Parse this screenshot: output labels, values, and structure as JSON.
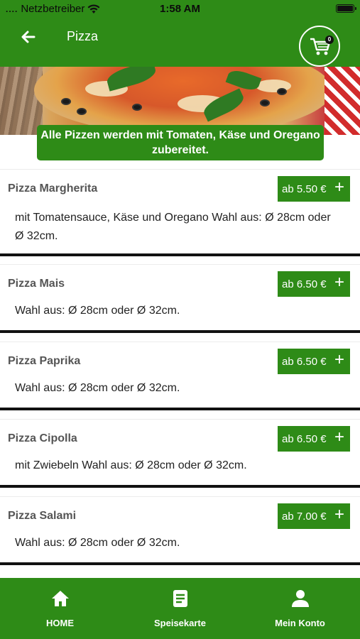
{
  "status_bar": {
    "carrier": "Netzbetreiber",
    "time": "1:58 AM"
  },
  "app_bar": {
    "title": "Pizza",
    "cart_count": "0"
  },
  "banner": {
    "text_line1": "Alle Pizzen werden mit Tomaten, Käse und Oregano",
    "text_line2": "zubereitet."
  },
  "items": [
    {
      "name": "Pizza Margherita",
      "price": "ab 5.50 €",
      "desc_line1": "mit Tomatensauce, Käse und Oregano Wahl aus: Ø 28cm oder",
      "desc_line2": "Ø 32cm."
    },
    {
      "name": "Pizza Mais",
      "price": "ab 6.50 €",
      "desc_line1": "Wahl aus: Ø 28cm oder Ø 32cm.",
      "desc_line2": ""
    },
    {
      "name": "Pizza Paprika",
      "price": "ab 6.50 €",
      "desc_line1": "Wahl aus: Ø 28cm oder Ø 32cm.",
      "desc_line2": ""
    },
    {
      "name": "Pizza Cipolla",
      "price": "ab 6.50 €",
      "desc_line1": "mit Zwiebeln Wahl aus: Ø 28cm oder Ø 32cm.",
      "desc_line2": ""
    },
    {
      "name": "Pizza Salami",
      "price": "ab 7.00 €",
      "desc_line1": "Wahl aus: Ø 28cm oder Ø 32cm.",
      "desc_line2": ""
    }
  ],
  "plus_symbol": "+",
  "bottom_nav": [
    {
      "label": "HOME",
      "icon": "home-icon"
    },
    {
      "label": "Speisekarte",
      "icon": "menu-list-icon"
    },
    {
      "label": "Mein Konto",
      "icon": "account-icon"
    }
  ],
  "colors": {
    "brand_green": "#2e8b17",
    "text_dark": "#222222",
    "text_name": "#555555"
  }
}
